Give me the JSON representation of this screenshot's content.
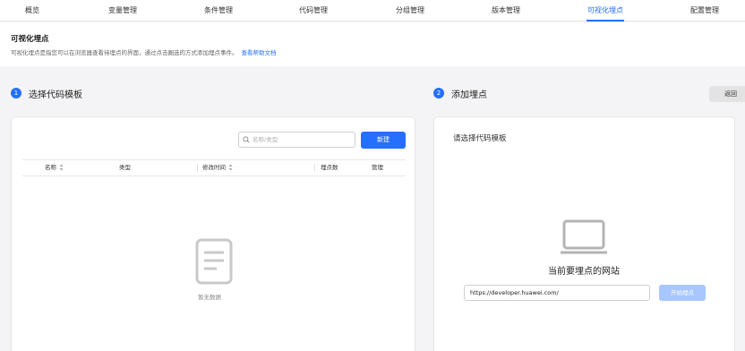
{
  "tabs": [
    {
      "label": "概览"
    },
    {
      "label": "变量管理"
    },
    {
      "label": "条件管理"
    },
    {
      "label": "代码管理"
    },
    {
      "label": "分组管理"
    },
    {
      "label": "版本管理"
    },
    {
      "label": "可视化埋点",
      "active": true
    },
    {
      "label": "配置管理"
    }
  ],
  "intro": {
    "title": "可视化埋点",
    "description": "可视化埋点是指您可以在浏览器查看待埋点的界面，通过点击圈选的方式添加埋点事件。",
    "help_link": "查看帮助文档"
  },
  "left": {
    "step_number": "1",
    "step_title": "选择代码模板",
    "search_placeholder": "名称/类型",
    "new_button": "新建",
    "columns": [
      "名称",
      "类型",
      "修改时间",
      "埋点数",
      "管理"
    ],
    "rows": [],
    "empty_text": "暂无数据"
  },
  "right": {
    "step_number": "2",
    "step_title": "添加埋点",
    "back_button": "返回",
    "subtitle": "请选择代码模板",
    "site_label": "当前要埋点的网站",
    "url_value": "https://developer.huawei.com/",
    "start_button": "开始埋点"
  },
  "colors": {
    "accent": "#256fff",
    "disabled_button": "#a8c6ff",
    "page_background": "#f4f4f6"
  },
  "icons": [
    "search-icon",
    "sort-icon",
    "document-empty-icon",
    "laptop-icon"
  ]
}
